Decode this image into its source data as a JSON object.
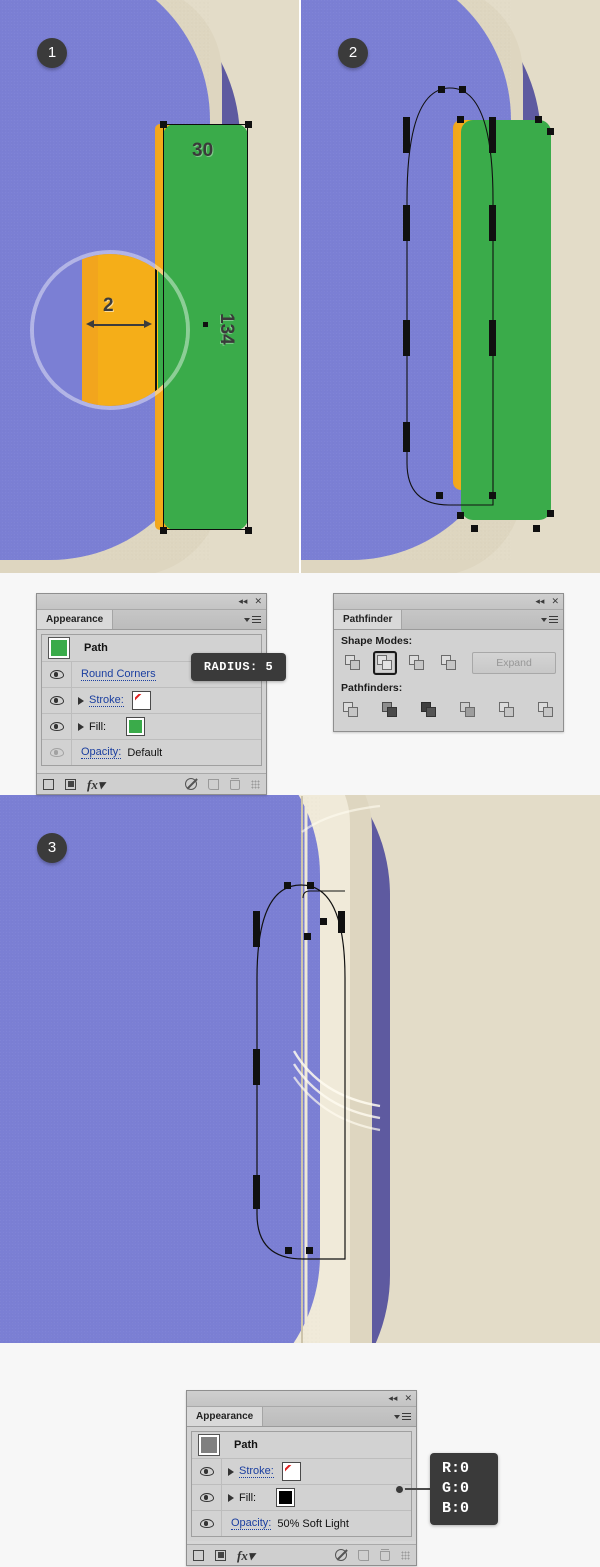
{
  "panels": [
    {
      "step": "1"
    },
    {
      "step": "2"
    },
    {
      "step": "3"
    }
  ],
  "illustration_1": {
    "badge": "1",
    "width_label": "30",
    "height_label": "134",
    "magnifier_measure": "2"
  },
  "illustration_2": {
    "badge": "2"
  },
  "illustration_3": {
    "badge": "3"
  },
  "appearance_panel_top": {
    "tab_label": "Appearance",
    "collapse_label": "◂◂",
    "close_label": "✕",
    "rows": [
      {
        "name": "Path",
        "type": "header",
        "thumb_color": "#3aab4a"
      },
      {
        "name": "Round Corners",
        "type": "effect",
        "eye": true
      },
      {
        "name": "Stroke:",
        "type": "stroke",
        "eye": true,
        "swatch": "none"
      },
      {
        "name": "Fill:",
        "type": "fill",
        "eye": true,
        "swatch": "#3aab4a"
      },
      {
        "name": "Opacity:",
        "type": "opacity",
        "eye": false,
        "value": "Default"
      }
    ],
    "footer_icons": [
      "add-new-stroke",
      "add-new-fill",
      "add-new-effect",
      "clear-appearance",
      "duplicate-item",
      "delete-item",
      "resize-grip"
    ]
  },
  "callout_radius": {
    "text": "RADIUS: 5"
  },
  "pathfinder_panel": {
    "tab_label": "Pathfinder",
    "collapse_label": "◂◂",
    "close_label": "✕",
    "shape_modes_label": "Shape Modes:",
    "pathfinders_label": "Pathfinders:",
    "expand_label": "Expand",
    "shape_modes": [
      {
        "name": "unite",
        "active": false
      },
      {
        "name": "minus-front",
        "active": true
      },
      {
        "name": "intersect",
        "active": false
      },
      {
        "name": "exclude",
        "active": false
      }
    ],
    "pathfinders": [
      {
        "name": "divide"
      },
      {
        "name": "trim"
      },
      {
        "name": "merge"
      },
      {
        "name": "crop"
      },
      {
        "name": "outline"
      },
      {
        "name": "minus-back"
      }
    ]
  },
  "appearance_panel_bottom": {
    "tab_label": "Appearance",
    "collapse_label": "◂◂",
    "close_label": "✕",
    "rows": [
      {
        "name": "Path",
        "type": "header",
        "thumb_color": "#808080"
      },
      {
        "name": "Stroke:",
        "type": "stroke",
        "eye": true,
        "swatch": "none"
      },
      {
        "name": "Fill:",
        "type": "fill",
        "eye": true,
        "swatch": "#000000"
      },
      {
        "name": "Opacity:",
        "type": "opacity",
        "eye": true,
        "value": "50% Soft Light"
      }
    ]
  },
  "callout_rgb": {
    "r": "R:0",
    "g": "G:0",
    "b": "B:0"
  },
  "colors": {
    "canvas": "#e3dcc8",
    "book_light": "#7b7fd4",
    "book_dark": "#5e5aa0",
    "green": "#3aab4a",
    "orange_left": "#f2a51d",
    "orange_right": "#fcc60f",
    "pages_cream": "#f0ead9",
    "pages_shadow": "#ded6c0",
    "badge_bg": "#3b3b3b",
    "callout_bg": "#3a3a3a",
    "panel_bg": "#d2d2d2",
    "link_blue": "#1b3fa0"
  }
}
